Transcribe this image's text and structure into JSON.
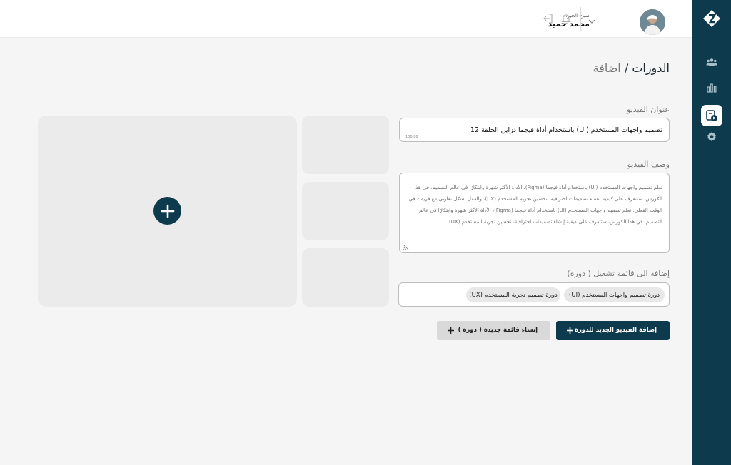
{
  "header": {
    "greeting": "صباح الخير...",
    "user_name": "محمد حميد"
  },
  "page": {
    "title": "الدورات",
    "separator": " / ",
    "subtitle": "اضافة"
  },
  "form": {
    "video_title": {
      "label": "عنوان الفيديو",
      "value": "تصميم واجهات المستخدم (UI) باستخدام أداة فيجما دزاين الحلقة 12",
      "counter": "100/88"
    },
    "video_description": {
      "label": "وصف الفيديو",
      "value": "تعلم تصميم واجهات المستخدم (UI) باستخدام أداة فيجما (Figma)، الأداة الأكثر شهرة وابتكارًا في عالم التصميم. في هذا الكورس، ستتعرف على كيفية إنشاء تصميمات احترافية، تحسين تجربة المستخدم (UX)، والعمل بشكل تعاوني مع فريقك في الوقت الفعلي. تعلم تصميم واجهات المستخدم (UI) باستخدام أداة فيجما (Figma)، الأداة الأكثر شهرة وابتكارًا في عالم التصميم. في هذا الكورس، ستتعرف على كيفية إنشاء تصميمات احترافية، تحسين تجربة المستخدم (UX)"
    },
    "playlist": {
      "label": "إضافة الى قائمة تشغيل ( دورة)",
      "chips": [
        "دورة تصميم واجهات المستخدم (UI)",
        "دورة تصميم تجربة المستخدم (UX)"
      ]
    }
  },
  "actions": {
    "add_video_label": "إضافة الفيديو الجديد للدورة",
    "create_playlist_label": "إنشاء قائمة جديدة ( دورة )"
  },
  "icons": {
    "logo": "brand-logo-icon",
    "nav": [
      "users-icon",
      "chart-icon",
      "video-course-icon",
      "settings-icon"
    ],
    "header": [
      "bell-icon",
      "logout-icon",
      "chevron-down-icon"
    ],
    "upload": "plus-icon"
  },
  "colors": {
    "primary": "#0e3a4e",
    "background": "#f5f5f5",
    "placeholder": "#ebebeb"
  }
}
